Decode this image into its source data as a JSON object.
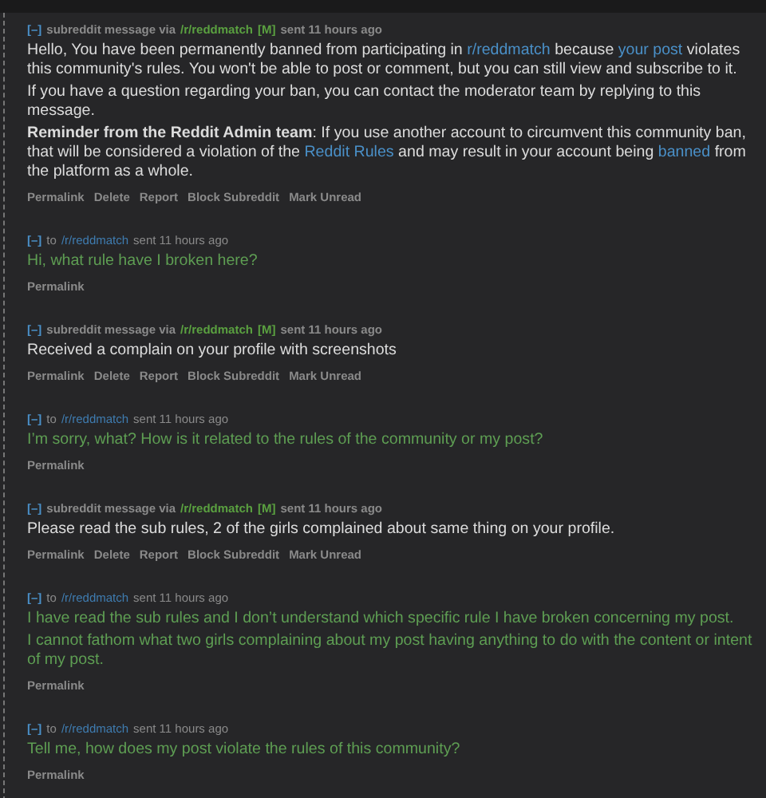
{
  "messages": [
    {
      "kind": "incoming",
      "toggle": "[–]",
      "prefix": "subreddit message via",
      "subreddit": "/r/reddmatch",
      "mod_tag": "[M]",
      "time": "sent 11 hours ago",
      "paragraphs": [
        [
          {
            "kind": "text",
            "text": "Hello, You have been permanently banned from participating in "
          },
          {
            "kind": "link",
            "text": "r/reddmatch"
          },
          {
            "kind": "text",
            "text": " because "
          },
          {
            "kind": "link",
            "text": "your post"
          },
          {
            "kind": "text",
            "text": " violates this community's rules. You won't be able to post or comment, but you can still view and subscribe to it."
          }
        ],
        [
          {
            "kind": "text",
            "text": "If you have a question regarding your ban, you can contact the moderator team by replying to this message."
          }
        ],
        [
          {
            "kind": "bold",
            "text": "Reminder from the Reddit Admin team"
          },
          {
            "kind": "text",
            "text": ": If you use another account to circumvent this community ban, that will be considered a violation of the "
          },
          {
            "kind": "link",
            "text": "Reddit Rules"
          },
          {
            "kind": "text",
            "text": " and may result in your account being "
          },
          {
            "kind": "link",
            "text": "banned"
          },
          {
            "kind": "text",
            "text": " from the platform as a whole."
          }
        ]
      ],
      "actions": [
        "Permalink",
        "Delete",
        "Report",
        "Block Subreddit",
        "Mark Unread"
      ]
    },
    {
      "kind": "outgoing",
      "toggle": "[–]",
      "prefix": "to",
      "subreddit": "/r/reddmatch",
      "time": "sent 11 hours ago",
      "paragraphs": [
        [
          {
            "kind": "text",
            "text": "Hi, what rule have I broken here?"
          }
        ]
      ],
      "actions": [
        "Permalink"
      ]
    },
    {
      "kind": "incoming",
      "toggle": "[–]",
      "prefix": "subreddit message via",
      "subreddit": "/r/reddmatch",
      "mod_tag": "[M]",
      "time": "sent 11 hours ago",
      "paragraphs": [
        [
          {
            "kind": "text",
            "text": "Received a complain on your profile with screenshots"
          }
        ]
      ],
      "actions": [
        "Permalink",
        "Delete",
        "Report",
        "Block Subreddit",
        "Mark Unread"
      ]
    },
    {
      "kind": "outgoing",
      "toggle": "[–]",
      "prefix": "to",
      "subreddit": "/r/reddmatch",
      "time": "sent 11 hours ago",
      "paragraphs": [
        [
          {
            "kind": "text",
            "text": "I’m sorry, what? How is it related to the rules of the community or my post?"
          }
        ]
      ],
      "actions": [
        "Permalink"
      ]
    },
    {
      "kind": "incoming",
      "toggle": "[–]",
      "prefix": "subreddit message via",
      "subreddit": "/r/reddmatch",
      "mod_tag": "[M]",
      "time": "sent 11 hours ago",
      "paragraphs": [
        [
          {
            "kind": "text",
            "text": "Please read the sub rules, 2 of the girls complained about same thing on your profile."
          }
        ]
      ],
      "actions": [
        "Permalink",
        "Delete",
        "Report",
        "Block Subreddit",
        "Mark Unread"
      ]
    },
    {
      "kind": "outgoing",
      "toggle": "[–]",
      "prefix": "to",
      "subreddit": "/r/reddmatch",
      "time": "sent 11 hours ago",
      "paragraphs": [
        [
          {
            "kind": "text",
            "text": "I have read the sub rules and I don’t understand which specific rule I have broken concerning my post."
          }
        ],
        [
          {
            "kind": "text",
            "text": "I cannot fathom what two girls complaining about my post having anything to do with the content or intent of my post."
          }
        ]
      ],
      "actions": [
        "Permalink"
      ]
    },
    {
      "kind": "outgoing",
      "toggle": "[–]",
      "prefix": "to",
      "subreddit": "/r/reddmatch",
      "time": "sent 11 hours ago",
      "paragraphs": [
        [
          {
            "kind": "text",
            "text": "Tell me, how does my post violate the rules of this community?"
          }
        ]
      ],
      "actions": [
        "Permalink"
      ]
    }
  ]
}
